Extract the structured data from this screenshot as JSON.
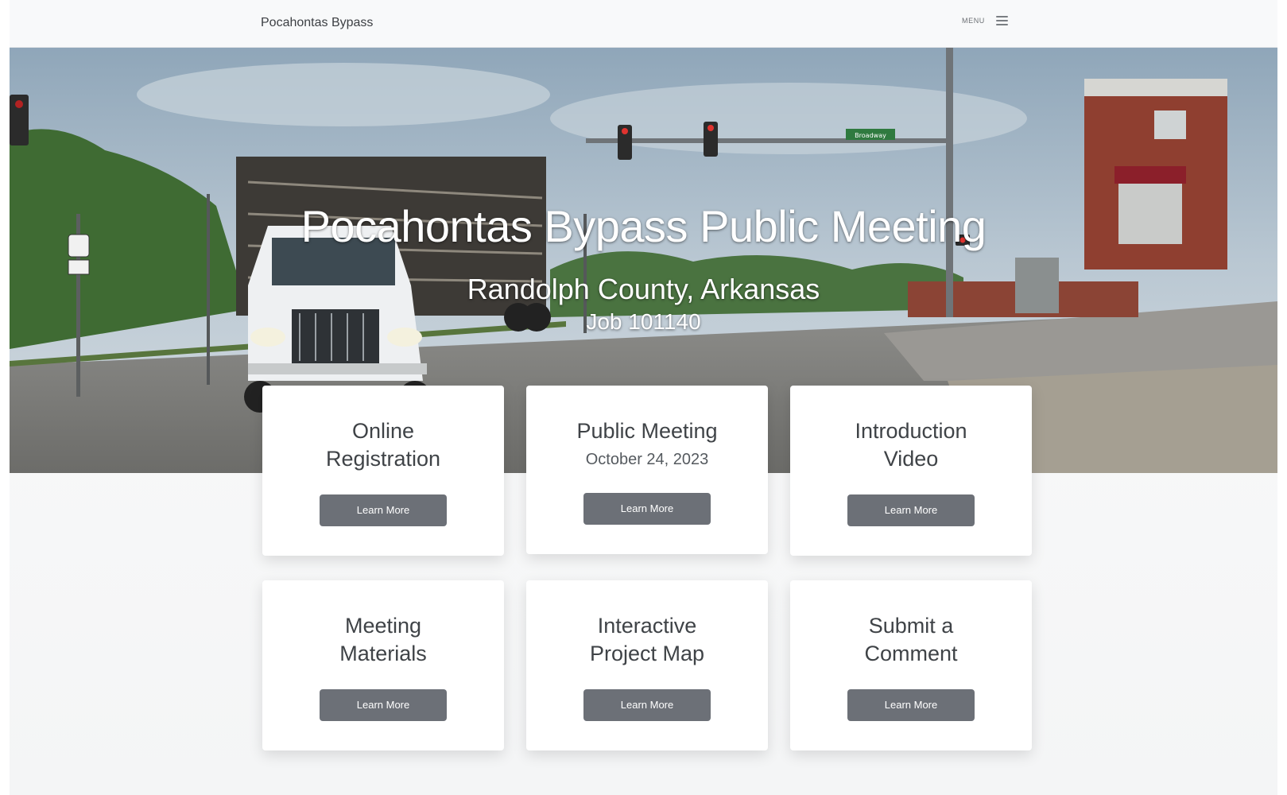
{
  "navbar": {
    "brand": "Pocahontas Bypass",
    "menu_label": "MENU",
    "menu_icon": "hamburger-icon"
  },
  "hero": {
    "title": "Pocahontas Bypass Public Meeting",
    "subtitle": "Randolph County, Arkansas",
    "job": "Job 101140",
    "street_sign": "Broadway"
  },
  "cards": [
    {
      "line1": "Online",
      "line2": "Registration",
      "button": "Learn More"
    },
    {
      "line1": "Public Meeting",
      "date": "October 24, 2023",
      "button": "Learn More"
    },
    {
      "line1": "Introduction",
      "line2": "Video",
      "button": "Learn More"
    },
    {
      "line1": "Meeting",
      "line2": "Materials",
      "button": "Learn More"
    },
    {
      "line1": "Interactive",
      "line2": "Project Map",
      "button": "Learn More"
    },
    {
      "line1": "Submit a",
      "line2": "Comment",
      "button": "Learn More"
    }
  ],
  "colors": {
    "button": "#6c7077",
    "card": "#ffffff",
    "navbar": "#f8f9fa"
  }
}
